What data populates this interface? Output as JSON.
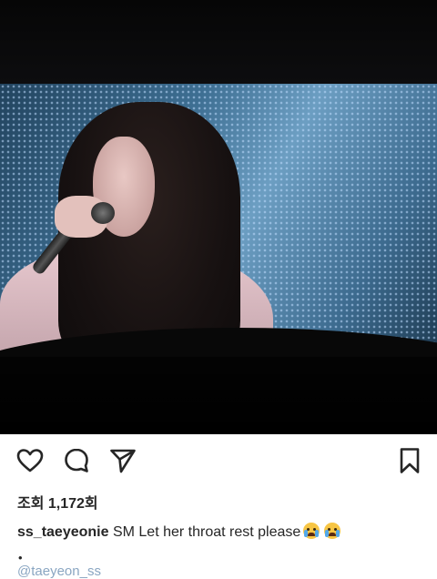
{
  "post": {
    "views_label": "조회 1,172회",
    "caption_user": "ss_taeyeonie",
    "caption_text": " SM Let her throat rest please",
    "caption_emojis": [
      "loudly-crying-face-emoji",
      "loudly-crying-face-emoji"
    ],
    "bullet": "•",
    "next_comment_user": "@taeyeon_ss"
  },
  "icons": {
    "like": "heart-icon",
    "comment": "comment-bubble-icon",
    "share": "paper-plane-icon",
    "save": "bookmark-icon"
  }
}
